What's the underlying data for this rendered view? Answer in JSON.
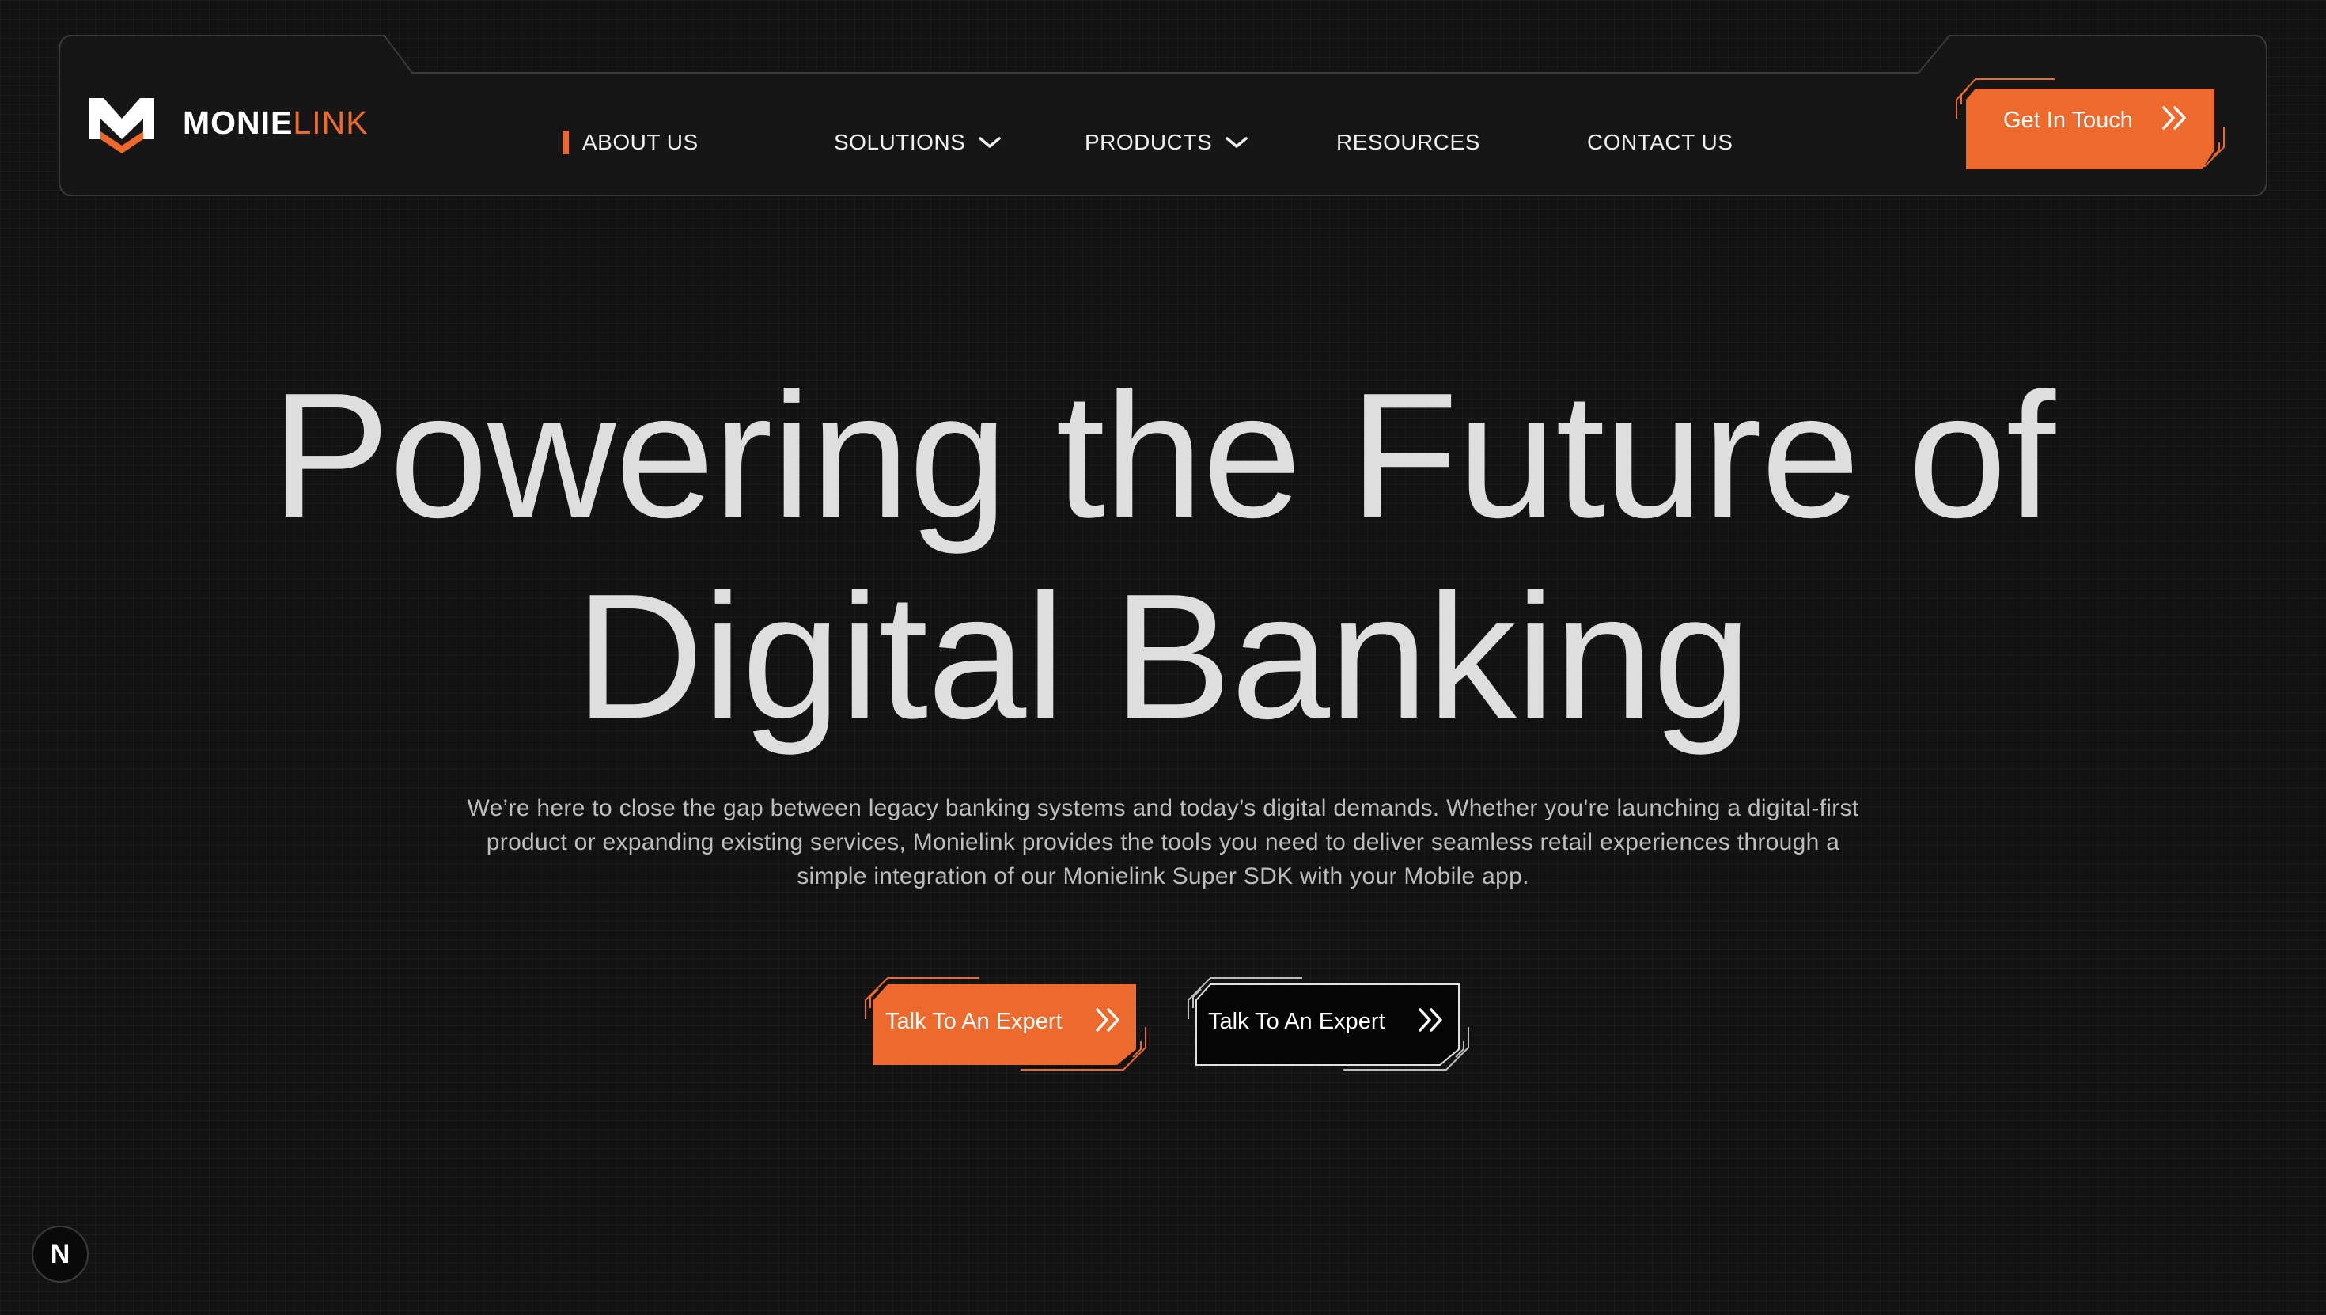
{
  "brand": {
    "name_bold": "MONIE",
    "name_accent": "LINK",
    "accent_color": "#ee6a2c"
  },
  "nav": {
    "items": [
      {
        "label": "ABOUT US",
        "active": true,
        "has_dropdown": false
      },
      {
        "label": "SOLUTIONS",
        "active": false,
        "has_dropdown": true
      },
      {
        "label": "PRODUCTS",
        "active": false,
        "has_dropdown": true
      },
      {
        "label": "RESOURCES",
        "active": false,
        "has_dropdown": false
      },
      {
        "label": "CONTACT US",
        "active": false,
        "has_dropdown": false
      }
    ],
    "cta_label": "Get In Touch",
    "cta_icon": "double-chevron-right-icon"
  },
  "hero": {
    "title_line1": "Powering the Future of",
    "title_line2": "Digital Banking",
    "description": "We’re here to close the gap between legacy banking systems and today’s digital demands. Whether you're launching a digital-first product or expanding existing services, Monielink provides the tools you need to deliver seamless retail experiences through a simple integration of our Monielink Super SDK with your Mobile app.",
    "primary_button": "Talk To An Expert",
    "secondary_button": "Talk To An Expert"
  },
  "dev_badge": {
    "letter": "N"
  },
  "colors": {
    "background": "#121212",
    "accent": "#ee6a2c",
    "text": "#dedede"
  }
}
